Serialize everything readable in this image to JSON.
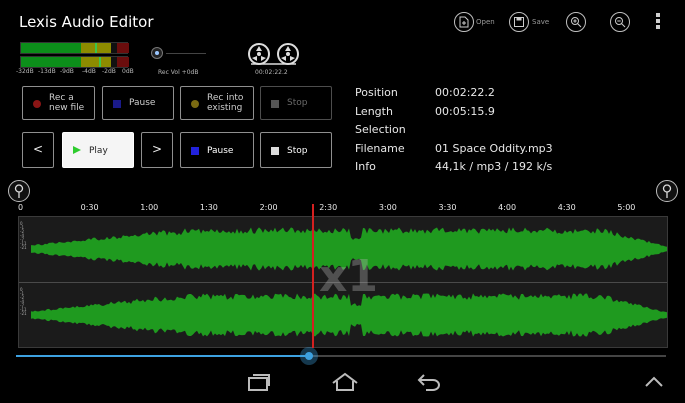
{
  "app": {
    "title": "Lexis Audio Editor"
  },
  "toolbar": {
    "open_label": "Open",
    "save_label": "Save",
    "icons": [
      "open-file-icon",
      "save-icon",
      "zoom-in-icon",
      "zoom-out-icon",
      "overflow-menu-icon"
    ]
  },
  "meters": {
    "scale": [
      "-32dB",
      "-13dB",
      "-9dB",
      "-4dB",
      "-2dB",
      "0dB"
    ],
    "levels": [
      0.72,
      0.73
    ],
    "rec_vol_label": "Rec Vol +0dB",
    "reel_time": "00:02:22.2"
  },
  "buttons": {
    "rec_new": "Rec a new file",
    "pause_rec": "Pause",
    "rec_existing": "Rec into existing",
    "stop_rec": "Stop",
    "prev": "<",
    "play": "Play",
    "next": ">",
    "pause_play": "Pause",
    "stop_play": "Stop"
  },
  "info": {
    "position_label": "Position",
    "position_value": "00:02:22.2",
    "length_label": "Length",
    "length_value": "00:05:15.9",
    "selection_label": "Selection",
    "selection_value": "",
    "filename_label": "Filename",
    "filename_value": "01 Space Oddity.mp3",
    "info_label": "Info",
    "info_value": "44,1k / mp3 / 192 k/s"
  },
  "timeline": {
    "start": "0",
    "ticks": [
      "0:30",
      "1:00",
      "1:30",
      "2:00",
      "2:30",
      "3:00",
      "3:30",
      "4:00",
      "4:30",
      "5:00"
    ],
    "length_seconds": 315.9,
    "cursor_seconds": 142.2,
    "db_labels": [
      "0",
      "-1",
      "-2",
      "-4",
      "-7",
      "-11",
      "-21"
    ],
    "zoom": "x1"
  },
  "seek": {
    "progress": 0.45
  },
  "colors": {
    "waveform": "#1f9a1f",
    "cursor": "#d42020",
    "accent": "#3da1e0"
  }
}
